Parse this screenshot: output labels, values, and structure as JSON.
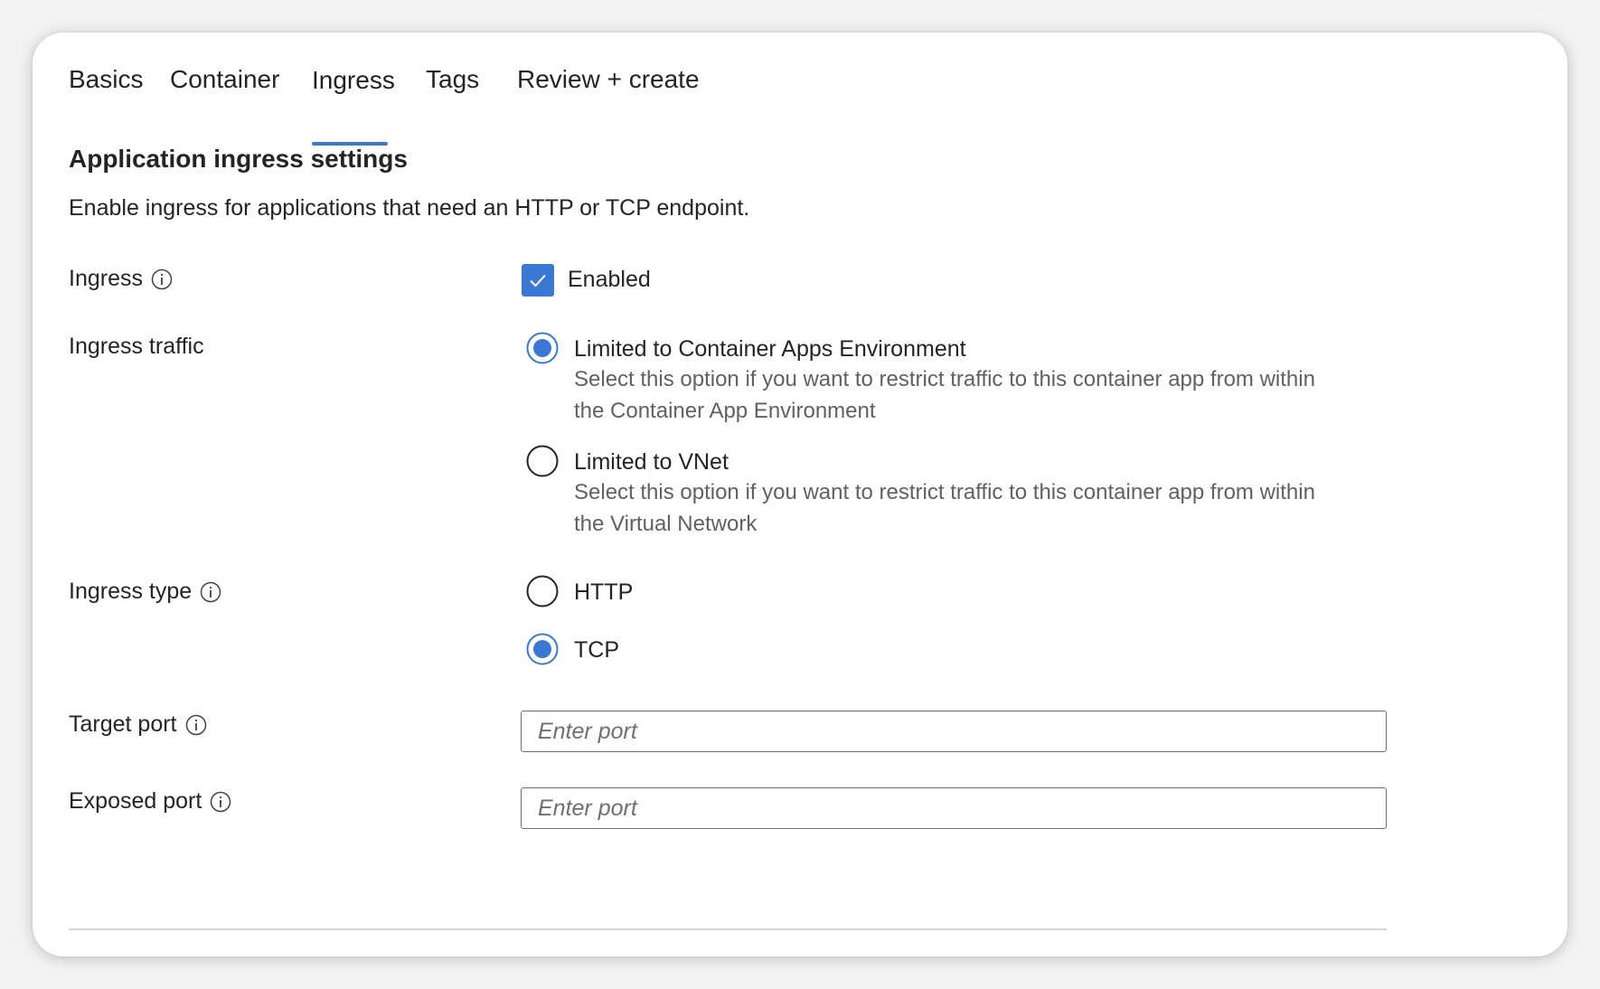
{
  "tabs": [
    {
      "label": "Basics",
      "active": false
    },
    {
      "label": "Container",
      "active": false
    },
    {
      "label": "Ingress",
      "active": true
    },
    {
      "label": "Tags",
      "active": false
    },
    {
      "label": "Review + create",
      "active": false
    }
  ],
  "section": {
    "title": "Application ingress settings",
    "description": "Enable ingress for applications that need an HTTP or TCP endpoint."
  },
  "ingress": {
    "label": "Ingress",
    "checkbox_label": "Enabled",
    "checked": true
  },
  "ingress_traffic": {
    "label": "Ingress traffic",
    "options": [
      {
        "label": "Limited to Container Apps Environment",
        "description": "Select this option if you want to restrict traffic to this container app from within the Container App Environment",
        "selected": true
      },
      {
        "label": "Limited to VNet",
        "description": "Select this option if you want to restrict traffic to this container app from within the Virtual Network",
        "selected": false
      }
    ]
  },
  "ingress_type": {
    "label": "Ingress type",
    "options": [
      {
        "label": "HTTP",
        "selected": false
      },
      {
        "label": "TCP",
        "selected": true
      }
    ]
  },
  "target_port": {
    "label": "Target port",
    "placeholder": "Enter port",
    "value": ""
  },
  "exposed_port": {
    "label": "Exposed port",
    "placeholder": "Enter port",
    "value": ""
  },
  "colors": {
    "accent": "#3b78d4",
    "description_text": "#616161",
    "divider": "#d6d6d6"
  }
}
